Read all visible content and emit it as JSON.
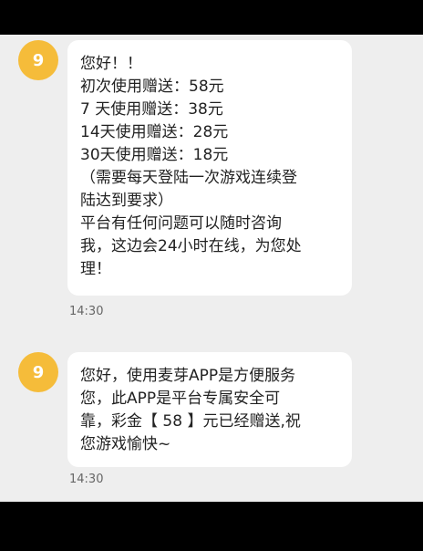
{
  "messages": [
    {
      "avatar_text": "9",
      "lines": [
        "您好！！",
        "初次使用赠送：58元",
        "7 天使用赠送：38元",
        "14天使用赠送：28元",
        "30天使用赠送：18元",
        "（需要每天登陆一次游戏连续登",
        "陆达到要求）",
        "平台有任何问题可以随时咨询",
        "我，这边会24小时在线，为您处",
        "理！"
      ],
      "time": "14:30"
    },
    {
      "avatar_text": "9",
      "lines": [
        "您好，使用麦芽APP是方便服务",
        "您，此APP是平台专属安全可",
        "靠，彩金【 58 】元已经赠送,祝",
        "您游戏愉快~"
      ],
      "time": "14:30"
    }
  ],
  "colors": {
    "avatar": "#f5bc3a",
    "background": "#eeeeee",
    "bubble": "#ffffff"
  }
}
